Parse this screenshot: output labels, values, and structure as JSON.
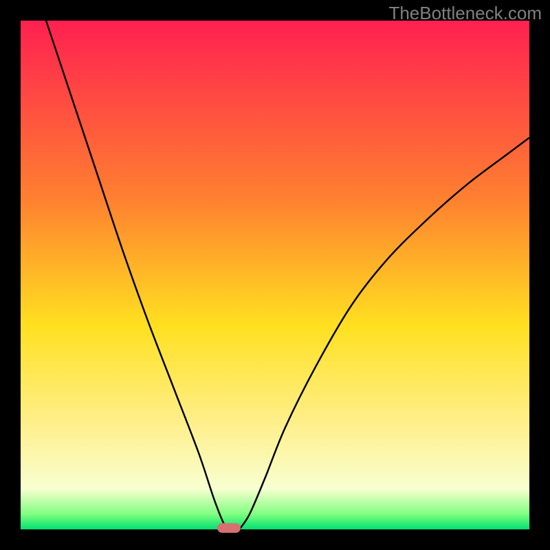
{
  "watermark": "TheBottleneck.com",
  "chart_data": {
    "type": "line",
    "title": "",
    "xlabel": "",
    "ylabel": "",
    "xlim": [
      0,
      100
    ],
    "ylim": [
      0,
      100
    ],
    "gradient_stops": [
      {
        "offset": 0,
        "color": "#ff2050"
      },
      {
        "offset": 35,
        "color": "#ff8030"
      },
      {
        "offset": 60,
        "color": "#ffe020"
      },
      {
        "offset": 80,
        "color": "#fff090"
      },
      {
        "offset": 92,
        "color": "#f8ffd0"
      },
      {
        "offset": 97,
        "color": "#80ff80"
      },
      {
        "offset": 100,
        "color": "#00e070"
      }
    ],
    "series": [
      {
        "name": "left-curve",
        "x": [
          5,
          10,
          15,
          20,
          25,
          30,
          35,
          38,
          40,
          41
        ],
        "y": [
          100,
          85,
          70,
          55,
          41,
          28,
          15,
          6,
          1,
          0
        ]
      },
      {
        "name": "right-curve",
        "x": [
          43,
          45,
          48,
          52,
          58,
          65,
          72,
          80,
          88,
          96,
          100
        ],
        "y": [
          0,
          3,
          10,
          20,
          32,
          44,
          53,
          61,
          68,
          74,
          77
        ]
      }
    ],
    "marker": {
      "x": 41,
      "y": 0
    }
  }
}
